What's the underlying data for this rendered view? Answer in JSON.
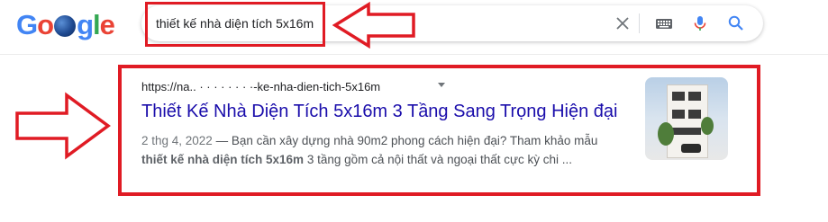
{
  "logo": {
    "letters": [
      "G",
      "o",
      "",
      "g",
      "l",
      "e"
    ]
  },
  "search": {
    "query": "thiết kế nhà diện tích 5x16m"
  },
  "icons": {
    "clear": "close-icon",
    "keyboard": "keyboard-icon",
    "mic": "mic-icon",
    "search": "search-icon",
    "arrow_left": "red-arrow-left",
    "arrow_right": "red-arrow-right"
  },
  "result": {
    "url": "https://na..  ·  ·  ·  ·  ·  ·  ·  ·-ke-nha-dien-tich-5x16m",
    "title": "Thiết Kế Nhà Diện Tích 5x16m 3 Tầng Sang Trọng Hiện đại",
    "date": "2 thg 4, 2022",
    "snippet_line1": " — Bạn cần xây dựng nhà 90m2 phong cách hiện đại? Tham khảo mẫu",
    "snippet_bold": "thiết kế nhà diện tích 5x16m",
    "snippet_line2": " 3 tầng gồm cả nội thất và ngoại thất cực kỳ chi ..."
  },
  "colors": {
    "annotation_red": "#e01b24",
    "link_blue": "#1a0dab",
    "google_blue": "#4285f4",
    "google_red": "#ea4335",
    "google_yellow": "#fbbc05",
    "google_green": "#34a853"
  }
}
